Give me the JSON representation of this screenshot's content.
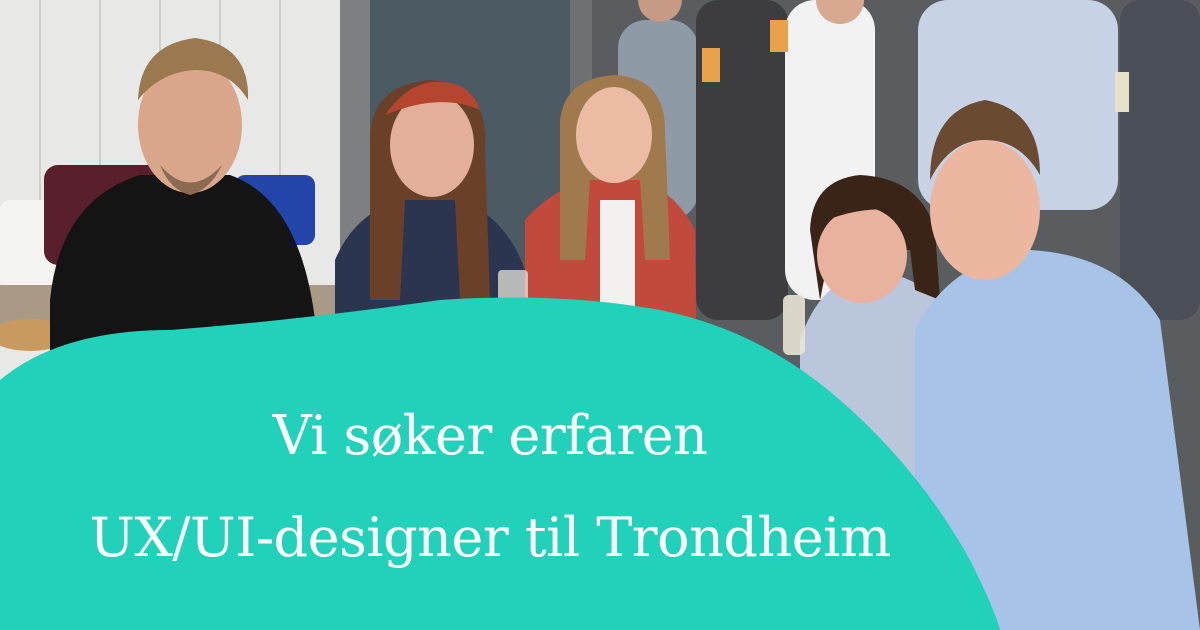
{
  "headline": {
    "line1": "Vi søker erfaren",
    "line2": "UX/UI-designer til Trondheim"
  },
  "colors": {
    "blob": "#21d1ba",
    "text": "#ffffff"
  }
}
